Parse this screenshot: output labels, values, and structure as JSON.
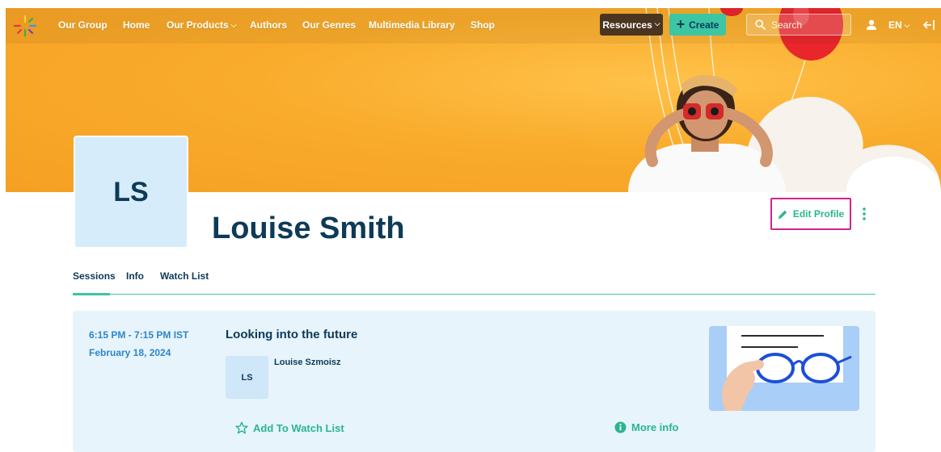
{
  "nav": {
    "items": [
      {
        "label": "Our Group"
      },
      {
        "label": "Home"
      },
      {
        "label": "Our Products",
        "has_dropdown": true
      },
      {
        "label": "Authors"
      },
      {
        "label": "Our Genres"
      },
      {
        "label": "Multimedia Library"
      },
      {
        "label": "Shop"
      }
    ],
    "resources_label": "Resources",
    "create_label": "Create",
    "search_placeholder": "Search",
    "language": "EN",
    "icons": {
      "logo": "spark-logo",
      "search": "search-icon",
      "user": "user-icon",
      "logout": "logout-icon"
    }
  },
  "colors": {
    "accent": "#3cc6a4",
    "banner": "#f9ab2b",
    "brand_text": "#0d3a57",
    "highlight_border": "#d2238f",
    "session_time": "#2d86c8",
    "card_bg": "#e7f4fc"
  },
  "profile": {
    "initials": "LS",
    "name": "Louise Smith",
    "edit_label": "Edit Profile"
  },
  "tabs": [
    {
      "label": "Sessions",
      "active": true
    },
    {
      "label": "Info",
      "active": false
    },
    {
      "label": "Watch List",
      "active": false
    }
  ],
  "session": {
    "time": "6:15 PM - 7:15 PM IST",
    "date": "February 18, 2024",
    "title": "Looking into the future",
    "speaker": {
      "initials": "LS",
      "name": "Louise Szmoisz"
    },
    "watch_label": "Add To Watch List",
    "more_label": "More info"
  }
}
